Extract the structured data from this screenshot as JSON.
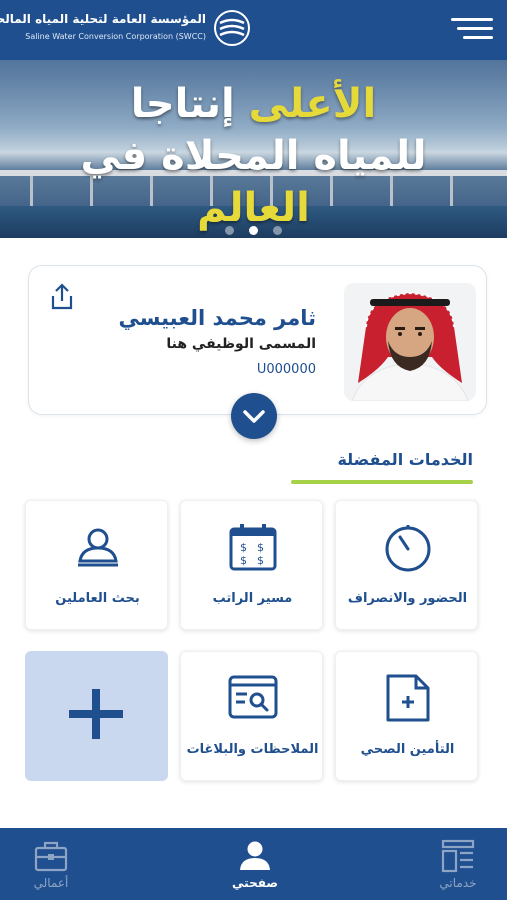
{
  "header": {
    "logo_ar": "المؤسسة العامة لتحلية المياه المالحة",
    "logo_en": "Saline Water Conversion Corporation (SWCC)",
    "menu_icon": "hamburger-menu-icon"
  },
  "banner": {
    "line1_yellow": "الأعلى",
    "line1_white": "إنتاجا",
    "line2": "للمياه المحلاة في",
    "line3": "العالم",
    "slides": 3,
    "active_slide": 1
  },
  "profile": {
    "name": "ثامر محمد العبيسي",
    "job_title": "المسمى الوظيفي هنا",
    "employee_id": "U000000",
    "share_icon": "share-icon",
    "expand_icon": "chevron-down-icon"
  },
  "favorites": {
    "title": "الخدمات المفضلة",
    "tiles": [
      {
        "label": "الحضور والانصراف",
        "icon": "timer-icon"
      },
      {
        "label": "مسير الراتب",
        "icon": "payroll-calendar-icon"
      },
      {
        "label": "بحث العاملين",
        "icon": "employee-search-icon"
      },
      {
        "label": "التأمين الصحي",
        "icon": "health-insurance-icon"
      },
      {
        "label": "الملاحظات والبلاغات",
        "icon": "notes-search-icon"
      },
      {
        "label": "",
        "icon": "plus-icon"
      }
    ]
  },
  "bottom_nav": {
    "items": [
      {
        "label": "خدماتي",
        "icon": "dashboard-icon",
        "active": false
      },
      {
        "label": "صفحتي",
        "icon": "user-icon",
        "active": true
      },
      {
        "label": "أعمالي",
        "icon": "briefcase-icon",
        "active": false
      }
    ]
  },
  "colors": {
    "primary": "#1f4f8f",
    "accent": "#a8d14a",
    "banner_highlight": "#e6d93a",
    "add_tile": "#c9d8ef"
  }
}
